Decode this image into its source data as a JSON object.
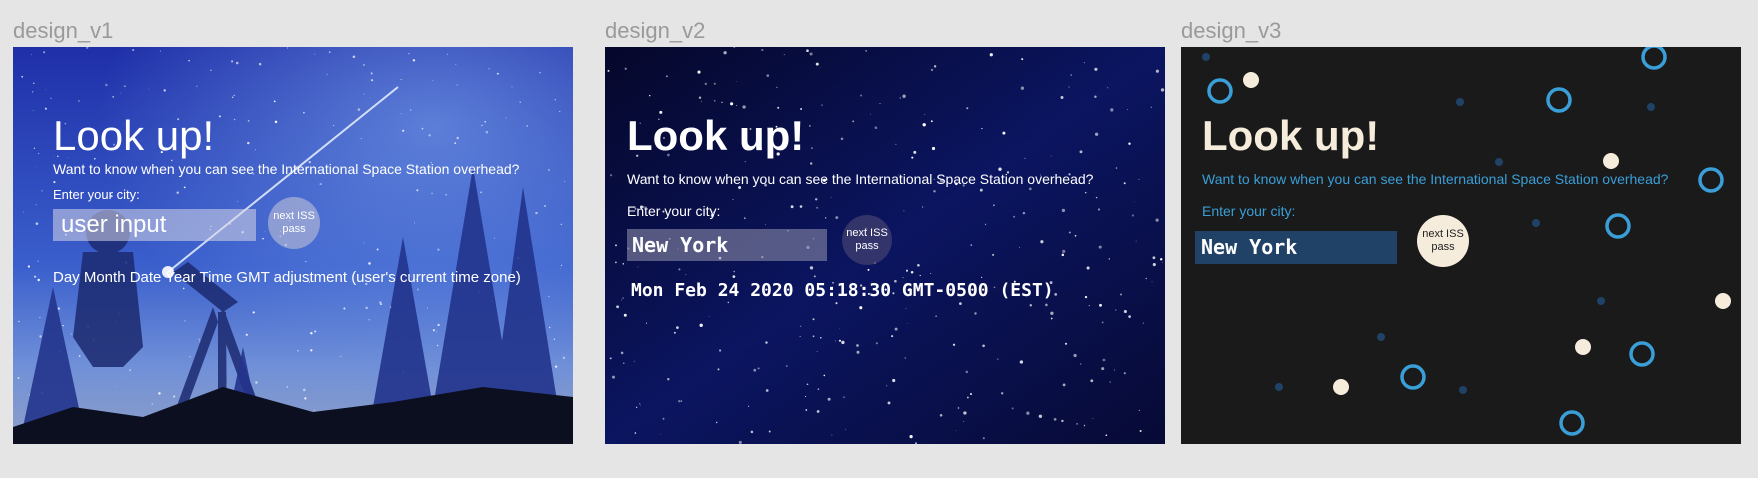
{
  "frames": [
    {
      "label": "design_v1",
      "title": "Look up!",
      "subtitle": "Want to know when you can see the International Space Station overhead?",
      "city_label": "Enter your city:",
      "city_value": "user input",
      "button_label": "next ISS pass",
      "time_text": "Day Month Date Year Time GMT adjustment (user's current time zone)"
    },
    {
      "label": "design_v2",
      "title": "Look up!",
      "subtitle": "Want to know when you can see the International Space Station overhead?",
      "city_label": "Enter your city:",
      "city_value": "New York",
      "button_label": "next ISS pass",
      "time_text": "Mon Feb 24 2020 05:18:30 GMT-0500 (EST)"
    },
    {
      "label": "design_v3",
      "title": "Look up!",
      "subtitle": "Want to know when you can see the International Space Station overhead?",
      "city_label": "Enter your city:",
      "city_value": "New York",
      "button_label": "next ISS pass"
    }
  ],
  "colors": {
    "canvas": "#e5e5e5",
    "v3_background": "#1a1a1a",
    "v3_accent_blue": "#3a9fd8",
    "v3_cream": "#f5ecdc"
  }
}
